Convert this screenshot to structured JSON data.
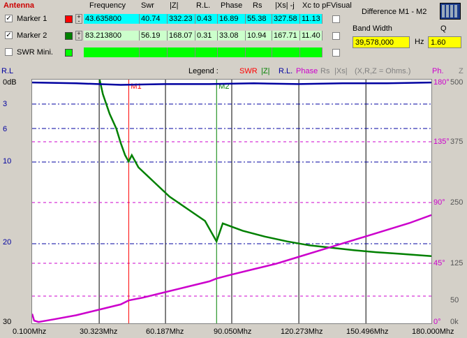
{
  "top": {
    "antenna_label": "Antenna",
    "headers": [
      "Frequency",
      "Swr",
      "|Z|",
      "R.L.",
      "Phase",
      "Rs",
      "|Xs| -j",
      "Xc to pF",
      "Visual"
    ],
    "markers": [
      {
        "label": "Marker 1",
        "checked": true,
        "color": "#ff0000",
        "values": [
          "43.635800",
          "40.74",
          "332.23",
          "0.43",
          "16.89",
          "55.38",
          "327.58",
          "11.13"
        ]
      },
      {
        "label": "Marker 2",
        "checked": true,
        "color": "#008000",
        "values": [
          "83.213800",
          "56.19",
          "168.07",
          "0.31",
          "33.08",
          "10.94",
          "167.71",
          "11.40"
        ]
      },
      {
        "label": "SWR Mini.",
        "checked": false,
        "color": "#00ff00",
        "values": [
          "",
          "",
          "",
          "",
          "",
          "",
          "",
          ""
        ]
      }
    ]
  },
  "difference": {
    "title": "Difference M1 - M2",
    "bandwidth_label": "Band Width",
    "bandwidth_value": "39,578,000",
    "hz_label": "Hz",
    "q_label": "Q",
    "q_value": "1.60",
    "calc_icon": "calculator-icon"
  },
  "legend": {
    "rl_left": "R.L",
    "legend_label": "Legend :",
    "swr": "SWR",
    "z": "|Z|",
    "rl": "R.L.",
    "phase": "Phase",
    "rs": "Rs",
    "xs": "|Xs|",
    "units": "(X,R,Z = Ohms.)",
    "ph": "Ph.",
    "zcol": "Z"
  },
  "colors": {
    "swr": "#ff0000",
    "z": "#008000",
    "rl": "#0000a0",
    "phase": "#cc00cc",
    "rs": "#808080",
    "chart_bg": "#ffffff"
  },
  "markers_on_chart": [
    "M1",
    "M2"
  ],
  "chart_data": {
    "type": "line",
    "x_unit": "Mhz",
    "xlim": [
      0.1,
      180.0
    ],
    "x_ticks": [
      "0.100Mhz",
      "30.323Mhz",
      "60.187Mhz",
      "90.050Mhz",
      "120.273Mhz",
      "150.496Mhz",
      "180.000Mhz"
    ],
    "left_axis_ticks": [
      "0dB",
      "3",
      "6",
      "10",
      "20",
      "30"
    ],
    "phase_ticks": [
      "180°",
      "135°",
      "90°",
      "45°",
      "0°"
    ],
    "z_ticks": [
      "500",
      "375",
      "250",
      "125",
      "50",
      "0k"
    ],
    "marker_freqs": [
      43.6358,
      83.2138
    ],
    "series": [
      {
        "name": "|Z|",
        "axis": "z",
        "x": [
          30.5,
          32,
          35,
          38,
          40,
          42,
          43.6,
          45,
          48,
          55,
          62,
          70,
          78,
          83.2,
          86,
          95,
          105,
          115,
          125,
          135,
          145,
          155,
          165,
          180
        ],
        "values": [
          500,
          470,
          430,
          400,
          370,
          345,
          332,
          345,
          320,
          290,
          260,
          235,
          210,
          168,
          205,
          190,
          178,
          168,
          160,
          155,
          150,
          146,
          143,
          138
        ]
      },
      {
        "name": "Phase",
        "axis": "phase",
        "x": [
          0.1,
          1,
          3,
          10,
          20,
          30,
          40,
          43.6,
          50,
          60,
          70,
          80,
          83.2,
          90,
          100,
          110,
          120,
          130,
          140,
          150,
          160,
          170,
          180
        ],
        "values": [
          7,
          2,
          1,
          3,
          6,
          10,
          14,
          16.9,
          19,
          23,
          27,
          31,
          33.1,
          36,
          40,
          44,
          49,
          54,
          59,
          64,
          69,
          74,
          80
        ]
      },
      {
        "name": "R.L.",
        "axis": "rl",
        "x": [
          0.1,
          20,
          40,
          60,
          80,
          100,
          120,
          140,
          160,
          180
        ],
        "values": [
          0.1,
          0.2,
          0.4,
          0.3,
          0.3,
          0.2,
          0.3,
          0.2,
          0.2,
          0.1
        ]
      }
    ]
  }
}
